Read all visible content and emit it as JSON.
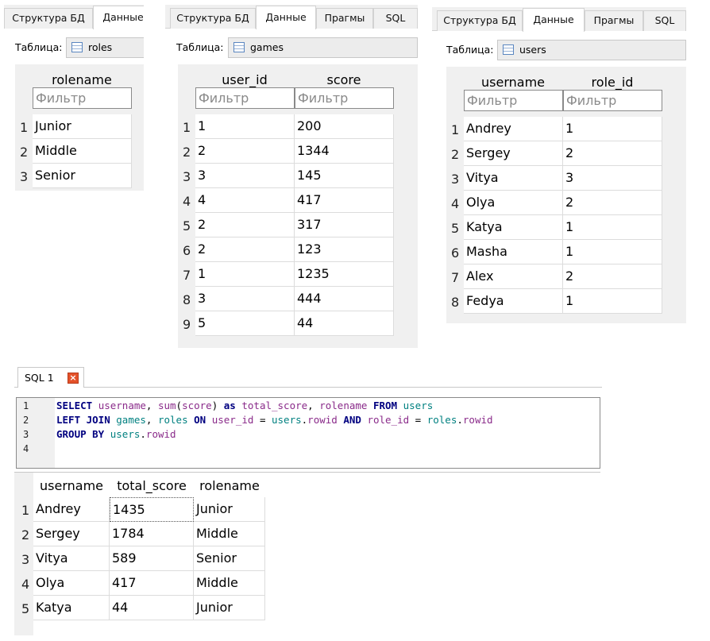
{
  "tabs": {
    "structure": "Структура БД",
    "data": "Данные",
    "pragmas": "Прагмы",
    "sql": "SQL"
  },
  "table_label": "Таблица:",
  "filter_placeholder": "Фильтр",
  "roles": {
    "table_name": "roles",
    "columns": [
      "rolename"
    ],
    "rows": [
      {
        "n": "1",
        "cells": [
          "Junior"
        ]
      },
      {
        "n": "2",
        "cells": [
          "Middle"
        ]
      },
      {
        "n": "3",
        "cells": [
          "Senior"
        ]
      }
    ]
  },
  "games": {
    "table_name": "games",
    "columns": [
      "user_id",
      "score"
    ],
    "rows": [
      {
        "n": "1",
        "cells": [
          "1",
          "200"
        ]
      },
      {
        "n": "2",
        "cells": [
          "2",
          "1344"
        ]
      },
      {
        "n": "3",
        "cells": [
          "3",
          "145"
        ]
      },
      {
        "n": "4",
        "cells": [
          "4",
          "417"
        ]
      },
      {
        "n": "5",
        "cells": [
          "2",
          "317"
        ]
      },
      {
        "n": "6",
        "cells": [
          "2",
          "123"
        ]
      },
      {
        "n": "7",
        "cells": [
          "1",
          "1235"
        ]
      },
      {
        "n": "8",
        "cells": [
          "3",
          "444"
        ]
      },
      {
        "n": "9",
        "cells": [
          "5",
          "44"
        ]
      }
    ]
  },
  "users": {
    "table_name": "users",
    "columns": [
      "username",
      "role_id"
    ],
    "rows": [
      {
        "n": "1",
        "cells": [
          "Andrey",
          "1"
        ]
      },
      {
        "n": "2",
        "cells": [
          "Sergey",
          "2"
        ]
      },
      {
        "n": "3",
        "cells": [
          "Vitya",
          "3"
        ]
      },
      {
        "n": "4",
        "cells": [
          "Olya",
          "2"
        ]
      },
      {
        "n": "5",
        "cells": [
          "Katya",
          "1"
        ]
      },
      {
        "n": "6",
        "cells": [
          "Masha",
          "1"
        ]
      },
      {
        "n": "7",
        "cells": [
          "Alex",
          "2"
        ]
      },
      {
        "n": "8",
        "cells": [
          "Fedya",
          "1"
        ]
      }
    ]
  },
  "sql_editor": {
    "tab_label": "SQL 1",
    "line_numbers": [
      "1",
      "2",
      "3",
      "4"
    ],
    "lines": [
      [
        {
          "t": "SELECT",
          "c": "kw"
        },
        {
          "t": " ",
          "c": "pl"
        },
        {
          "t": "username",
          "c": "id"
        },
        {
          "t": ", ",
          "c": "pl"
        },
        {
          "t": "sum",
          "c": "id"
        },
        {
          "t": "(",
          "c": "pl"
        },
        {
          "t": "score",
          "c": "id"
        },
        {
          "t": ") ",
          "c": "pl"
        },
        {
          "t": "as",
          "c": "kw"
        },
        {
          "t": " ",
          "c": "pl"
        },
        {
          "t": "total_score",
          "c": "id"
        },
        {
          "t": ", ",
          "c": "pl"
        },
        {
          "t": "rolename",
          "c": "id"
        },
        {
          "t": " ",
          "c": "pl"
        },
        {
          "t": "FROM",
          "c": "kw"
        },
        {
          "t": " ",
          "c": "pl"
        },
        {
          "t": "users",
          "c": "tb"
        }
      ],
      [
        {
          "t": "LEFT JOIN",
          "c": "kw"
        },
        {
          "t": " ",
          "c": "pl"
        },
        {
          "t": "games",
          "c": "tb"
        },
        {
          "t": ", ",
          "c": "pl"
        },
        {
          "t": "roles",
          "c": "tb"
        },
        {
          "t": " ",
          "c": "pl"
        },
        {
          "t": "ON",
          "c": "kw"
        },
        {
          "t": " ",
          "c": "pl"
        },
        {
          "t": "user_id",
          "c": "id"
        },
        {
          "t": " = ",
          "c": "pl"
        },
        {
          "t": "users",
          "c": "tb"
        },
        {
          "t": ".",
          "c": "pl"
        },
        {
          "t": "rowid",
          "c": "id"
        },
        {
          "t": " ",
          "c": "pl"
        },
        {
          "t": "AND",
          "c": "kw"
        },
        {
          "t": " ",
          "c": "pl"
        },
        {
          "t": "role_id",
          "c": "id"
        },
        {
          "t": " = ",
          "c": "pl"
        },
        {
          "t": "roles",
          "c": "tb"
        },
        {
          "t": ".",
          "c": "pl"
        },
        {
          "t": "rowid",
          "c": "id"
        }
      ],
      [
        {
          "t": "GROUP BY",
          "c": "kw"
        },
        {
          "t": " ",
          "c": "pl"
        },
        {
          "t": "users",
          "c": "tb"
        },
        {
          "t": ".",
          "c": "pl"
        },
        {
          "t": "rowid",
          "c": "id"
        }
      ],
      []
    ]
  },
  "result": {
    "columns": [
      "username",
      "total_score",
      "rolename"
    ],
    "rows": [
      {
        "n": "1",
        "cells": [
          "Andrey",
          "1435",
          "Junior"
        ]
      },
      {
        "n": "2",
        "cells": [
          "Sergey",
          "1784",
          "Middle"
        ]
      },
      {
        "n": "3",
        "cells": [
          "Vitya",
          "589",
          "Senior"
        ]
      },
      {
        "n": "4",
        "cells": [
          "Olya",
          "417",
          "Middle"
        ]
      },
      {
        "n": "5",
        "cells": [
          "Katya",
          "44",
          "Junior"
        ]
      }
    ]
  }
}
